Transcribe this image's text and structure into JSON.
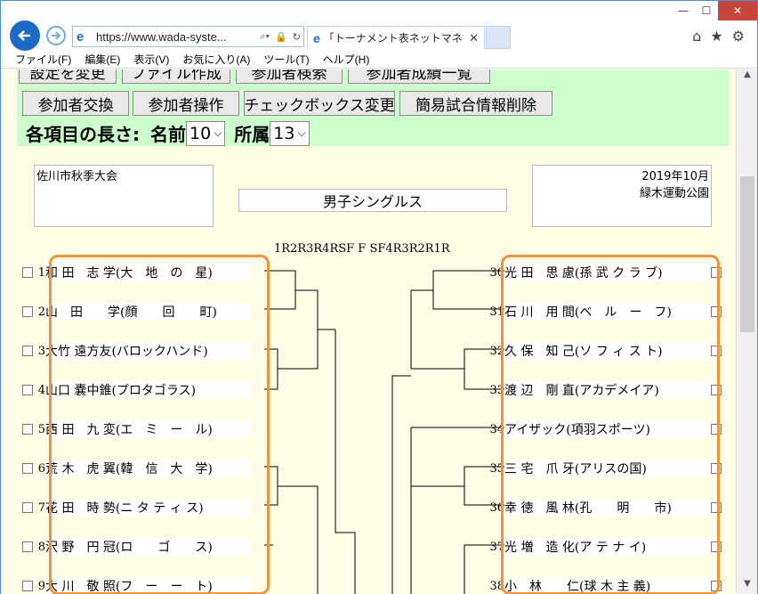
{
  "browser": {
    "url": "https://www.wada-syste...",
    "tab_title": "「トーナメント表ネットマネージャ...",
    "window_min": "—",
    "window_max": "☐",
    "window_close": "✕",
    "icons": [
      "home-icon",
      "star-icon",
      "gear-icon"
    ]
  },
  "menu": [
    "ファイル(F)",
    "編集(E)",
    "表示(V)",
    "お気に入り(A)",
    "ツール(T)",
    "ヘルプ(H)"
  ],
  "buttons_top": [
    "設定を変更",
    "ファイル作成",
    "参加者検索",
    "参加者成績一覧"
  ],
  "buttons_row2": [
    "参加者交換",
    "参加者操作",
    "チェックボックス変更",
    "簡易試合情報削除"
  ],
  "length_settings": {
    "label": "各項目の長さ:",
    "name_label": "名前",
    "name_value": "10",
    "affil_label": "所属",
    "affil_value": "13"
  },
  "tournament": {
    "left_info": "佐川市秋季大会",
    "right_info_line1": "2019年10月",
    "right_info_line2": "緑木運動公園",
    "event_title": "男子シングルス",
    "round_header": "1R2R3R4RSF F SF4R3R2R1R"
  },
  "left_players": [
    {
      "num": "1",
      "entry": "和 田　志 学(大　地　の　星)"
    },
    {
      "num": "2",
      "entry": "山　田　　学(顔　　回　　町)"
    },
    {
      "num": "3",
      "entry": "大竹 遠方友(バロックハンド)"
    },
    {
      "num": "4",
      "entry": "山口 嚢中錐(プロタゴラス)"
    },
    {
      "num": "5",
      "entry": "西 田　九 変(エ　ミ　ー　ル)"
    },
    {
      "num": "6",
      "entry": "荒 木　虎 翼(韓　信　大　学)"
    },
    {
      "num": "7",
      "entry": "花 田　時 勢(ニ タ テ ィ ス)"
    },
    {
      "num": "8",
      "entry": "沢 野　円 冠(ロ　　ゴ　　ス)"
    },
    {
      "num": "9",
      "entry": "大 川　敬 照(フ　ー　ー　ト)"
    }
  ],
  "right_players": [
    {
      "num": "30",
      "entry": "光 田　思 慮(孫 武 ク ラ ブ)"
    },
    {
      "num": "31",
      "entry": "石 川　用 間(ベ　ル　ー　フ)"
    },
    {
      "num": "32",
      "entry": "久 保　知 己(ソ フ ィ ス ト)"
    },
    {
      "num": "33",
      "entry": "渡 辺　剛 直(アカデメイア)"
    },
    {
      "num": "34",
      "entry": "アイザック(項羽スポーツ)"
    },
    {
      "num": "35",
      "entry": "三 宅　爪 牙(アリスの国)"
    },
    {
      "num": "36",
      "entry": "幸 徳　風 林(孔　　明　　市)"
    },
    {
      "num": "37",
      "entry": "光 増　造 化(ア テ ナ イ)"
    },
    {
      "num": "38",
      "entry": "小　林　　仁(球 木 主 義)"
    }
  ]
}
